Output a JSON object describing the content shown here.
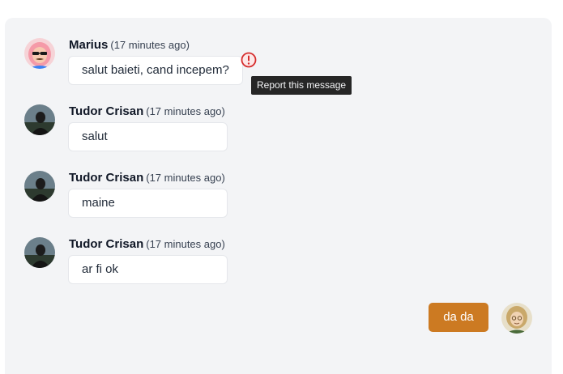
{
  "messages": [
    {
      "author": "Marius",
      "time": "(17 minutes ago)",
      "text": "salut baieti, cand incepem?",
      "avatar": "cartoon-avatar-pink-hair-sunglasses"
    },
    {
      "author": "Tudor Crisan",
      "time": "(17 minutes ago)",
      "text": "salut",
      "avatar": "photo-avatar"
    },
    {
      "author": "Tudor Crisan",
      "time": "(17 minutes ago)",
      "text": "maine",
      "avatar": "photo-avatar"
    },
    {
      "author": "Tudor Crisan",
      "time": "(17 minutes ago)",
      "text": "ar fi ok",
      "avatar": "photo-avatar"
    }
  ],
  "report": {
    "icon": "alert-circle-icon",
    "tooltip": "Report this message",
    "color": "#e11d1d"
  },
  "own_message": {
    "text": "da da",
    "color": "#cc7a22",
    "avatar": "cartoon-avatar-blonde"
  }
}
